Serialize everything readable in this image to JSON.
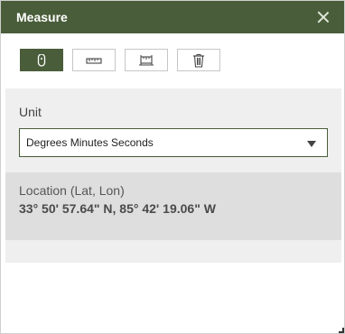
{
  "widget": {
    "title": "Measure",
    "close_icon": "close-icon"
  },
  "toolbar": {
    "tools": [
      {
        "icon": "location-pin-icon",
        "active": true
      },
      {
        "icon": "distance-ruler-icon",
        "active": false
      },
      {
        "icon": "area-measure-icon",
        "active": false
      },
      {
        "icon": "trash-icon",
        "active": false
      }
    ]
  },
  "unit": {
    "label": "Unit",
    "selected": "Degrees Minutes Seconds"
  },
  "result": {
    "label": "Location (Lat, Lon)",
    "value": "33° 50' 57.64\" N, 85° 42' 19.06\" W"
  },
  "colors": {
    "accent": "#4a5d3a",
    "panel_bg": "#efefef",
    "result_bg": "#dedede"
  }
}
